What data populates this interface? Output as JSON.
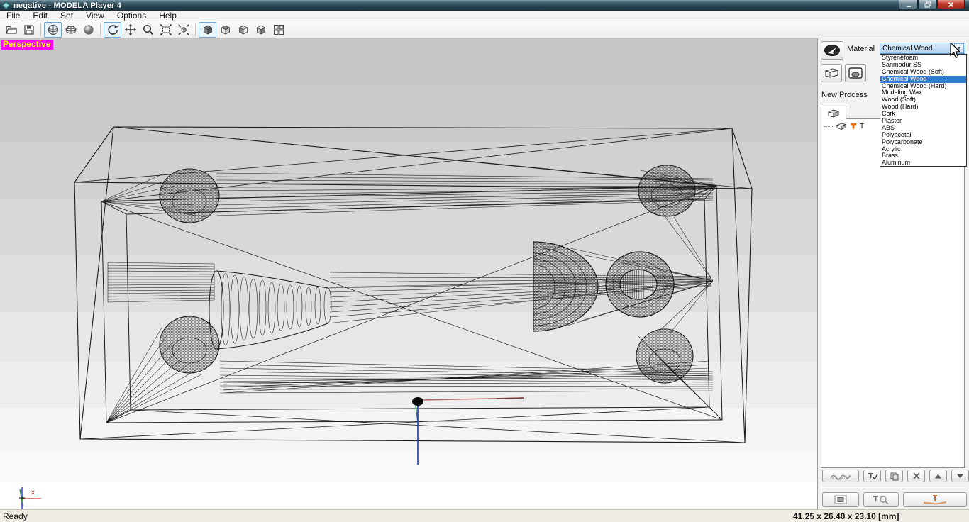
{
  "window": {
    "title": "negative - MODELA Player 4",
    "controls": {
      "minimize": "minimize",
      "maximize": "maximize",
      "close": "close"
    }
  },
  "menu_bar": {
    "items": [
      "File",
      "Edit",
      "Set",
      "View",
      "Options",
      "Help"
    ]
  },
  "toolbar": {
    "buttons": [
      "open",
      "save",
      "wireframe-view",
      "hidden-line-view",
      "shaded-view",
      "rotate-view",
      "pan-view",
      "zoom-view",
      "fit-view",
      "zoom-part-view",
      "iso-view-1",
      "iso-view-2",
      "iso-view-3",
      "iso-view-4",
      "multi-window-view"
    ],
    "selected": [
      "wireframe-view",
      "rotate-view",
      "iso-view-1"
    ]
  },
  "viewport": {
    "projection_label": "Perspective",
    "axis_label_x": "x"
  },
  "right_panel": {
    "material_label": "Material",
    "material_value": "Chemical Wood",
    "material_options": [
      {
        "label": "Styrenefoam",
        "selected": false
      },
      {
        "label": "Sanmodur SS",
        "selected": false
      },
      {
        "label": "Chemical Wood (Soft)",
        "selected": false
      },
      {
        "label": "Chemical Wood",
        "selected": true
      },
      {
        "label": "Chemical Wood (Hard)",
        "selected": false
      },
      {
        "label": "Modeling Wax",
        "selected": false
      },
      {
        "label": "Wood (Soft)",
        "selected": false
      },
      {
        "label": "Wood (Hard)",
        "selected": false
      },
      {
        "label": "Cork",
        "selected": false
      },
      {
        "label": "Plaster",
        "selected": false
      },
      {
        "label": "ABS",
        "selected": false
      },
      {
        "label": "Polyacetal",
        "selected": false
      },
      {
        "label": "Polycarbonate",
        "selected": false
      },
      {
        "label": "Acrylic",
        "selected": false
      },
      {
        "label": "Brass",
        "selected": false
      },
      {
        "label": "Aluminum",
        "selected": false
      }
    ],
    "new_process_label": "New Process",
    "tree_item_label": "T",
    "icons": [
      "machine-select-icon",
      "model-box-icon",
      "origin-setup-icon",
      "process-tab-cube-icon",
      "model-cube-icon",
      "milling-tool-icon",
      "toolpath-icon",
      "tool-check-icon",
      "copy-icon",
      "delete-icon",
      "move-up-icon",
      "move-down-icon",
      "preview-icon",
      "tool-detail-icon",
      "start-cutting-icon"
    ]
  },
  "status_bar": {
    "left": "Ready",
    "dimensions": "41.25 x 26.40 x 23.10 [mm]"
  },
  "colors": {
    "selection_blue": "#2f7cd6",
    "perspective_bg": "#ff00ff",
    "perspective_text": "#ffff00",
    "axis_x_red": "#b06060",
    "axis_y_green": "#2d8b2d",
    "axis_z_blue": "#2233bb",
    "tool_orange": "#e8700a"
  }
}
